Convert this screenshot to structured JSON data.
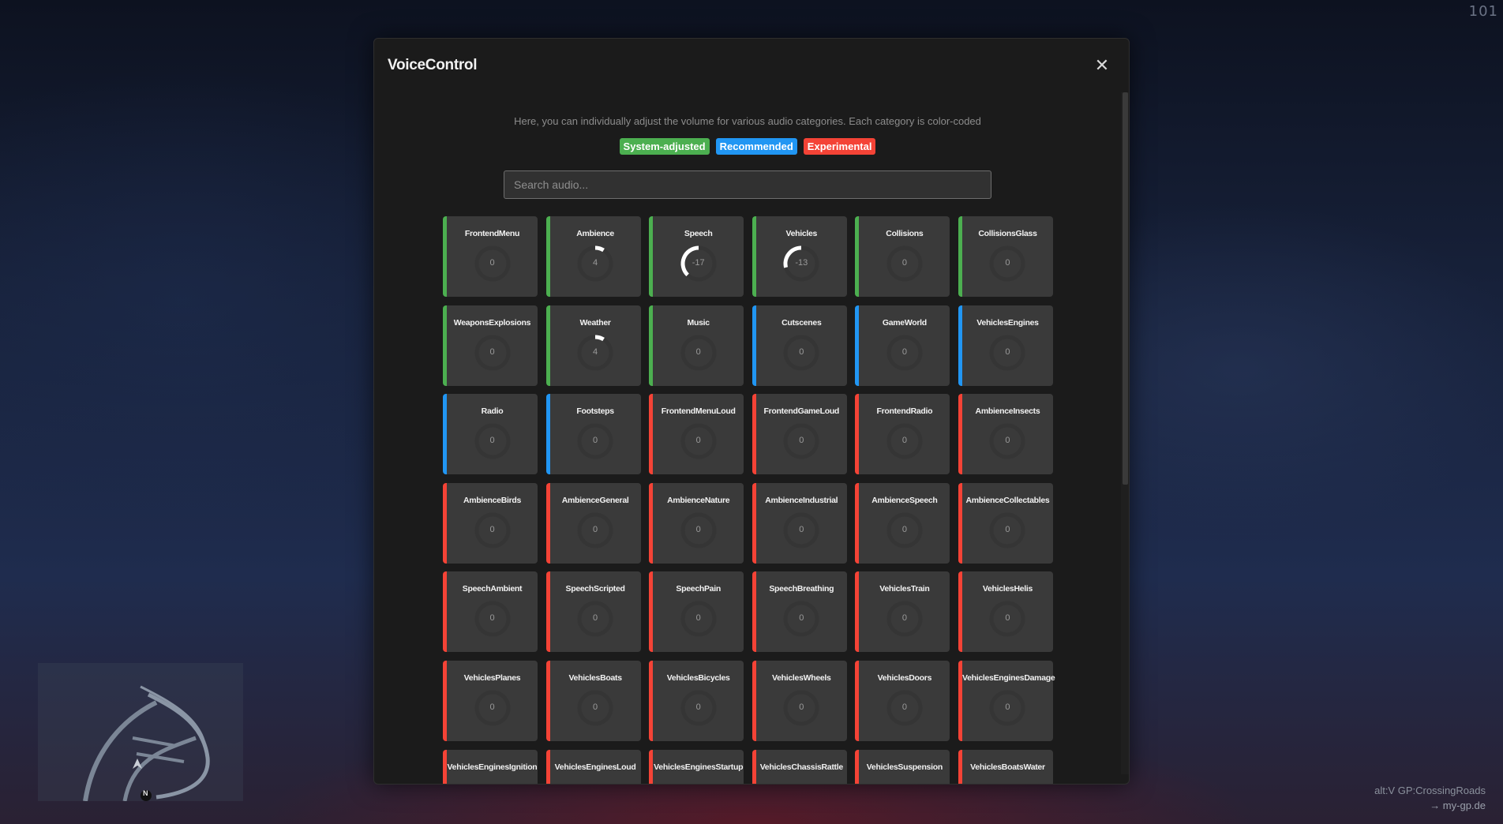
{
  "hud": {
    "fps": "101",
    "server_line1": "alt:V GP:CrossingRoads",
    "server_line2": "→ my-gp.de",
    "compass": "N"
  },
  "modal": {
    "title": "VoiceControl",
    "close_icon": "close-icon",
    "description": "Here, you can individually adjust the volume for various audio categories. Each category is color-coded",
    "legend": [
      {
        "label": "System-adjusted",
        "color": "#4caf50"
      },
      {
        "label": "Recommended",
        "color": "#2196f3"
      },
      {
        "label": "Experimental",
        "color": "#f44336"
      }
    ],
    "search_placeholder": "Search audio..."
  },
  "categories": [
    {
      "name": "FrontendMenu",
      "value": 0,
      "type": "system"
    },
    {
      "name": "Ambience",
      "value": 4,
      "type": "system"
    },
    {
      "name": "Speech",
      "value": -17,
      "type": "system"
    },
    {
      "name": "Vehicles",
      "value": -13,
      "type": "system"
    },
    {
      "name": "Collisions",
      "value": 0,
      "type": "system"
    },
    {
      "name": "CollisionsGlass",
      "value": 0,
      "type": "system"
    },
    {
      "name": "WeaponsExplosions",
      "value": 0,
      "type": "system"
    },
    {
      "name": "Weather",
      "value": 4,
      "type": "system"
    },
    {
      "name": "Music",
      "value": 0,
      "type": "system"
    },
    {
      "name": "Cutscenes",
      "value": 0,
      "type": "recommended"
    },
    {
      "name": "GameWorld",
      "value": 0,
      "type": "recommended"
    },
    {
      "name": "VehiclesEngines",
      "value": 0,
      "type": "recommended"
    },
    {
      "name": "Radio",
      "value": 0,
      "type": "recommended"
    },
    {
      "name": "Footsteps",
      "value": 0,
      "type": "recommended"
    },
    {
      "name": "FrontendMenuLoud",
      "value": 0,
      "type": "experimental"
    },
    {
      "name": "FrontendGameLoud",
      "value": 0,
      "type": "experimental"
    },
    {
      "name": "FrontendRadio",
      "value": 0,
      "type": "experimental"
    },
    {
      "name": "AmbienceInsects",
      "value": 0,
      "type": "experimental"
    },
    {
      "name": "AmbienceBirds",
      "value": 0,
      "type": "experimental"
    },
    {
      "name": "AmbienceGeneral",
      "value": 0,
      "type": "experimental"
    },
    {
      "name": "AmbienceNature",
      "value": 0,
      "type": "experimental"
    },
    {
      "name": "AmbienceIndustrial",
      "value": 0,
      "type": "experimental"
    },
    {
      "name": "AmbienceSpeech",
      "value": 0,
      "type": "experimental"
    },
    {
      "name": "AmbienceCollectables",
      "value": 0,
      "type": "experimental"
    },
    {
      "name": "SpeechAmbient",
      "value": 0,
      "type": "experimental"
    },
    {
      "name": "SpeechScripted",
      "value": 0,
      "type": "experimental"
    },
    {
      "name": "SpeechPain",
      "value": 0,
      "type": "experimental"
    },
    {
      "name": "SpeechBreathing",
      "value": 0,
      "type": "experimental"
    },
    {
      "name": "VehiclesTrain",
      "value": 0,
      "type": "experimental"
    },
    {
      "name": "VehiclesHelis",
      "value": 0,
      "type": "experimental"
    },
    {
      "name": "VehiclesPlanes",
      "value": 0,
      "type": "experimental"
    },
    {
      "name": "VehiclesBoats",
      "value": 0,
      "type": "experimental"
    },
    {
      "name": "VehiclesBicycles",
      "value": 0,
      "type": "experimental"
    },
    {
      "name": "VehiclesWheels",
      "value": 0,
      "type": "experimental"
    },
    {
      "name": "VehiclesDoors",
      "value": 0,
      "type": "experimental"
    },
    {
      "name": "VehiclesEnginesDamage",
      "value": 0,
      "type": "experimental"
    },
    {
      "name": "VehiclesEnginesIgnition",
      "value": null,
      "type": "experimental"
    },
    {
      "name": "VehiclesEnginesLoud",
      "value": null,
      "type": "experimental"
    },
    {
      "name": "VehiclesEnginesStartup",
      "value": null,
      "type": "experimental"
    },
    {
      "name": "VehiclesChassisRattle",
      "value": null,
      "type": "experimental"
    },
    {
      "name": "VehiclesSuspension",
      "value": null,
      "type": "experimental"
    },
    {
      "name": "VehiclesBoatsWater",
      "value": null,
      "type": "experimental"
    }
  ],
  "type_colors": {
    "system": "#4caf50",
    "recommended": "#2196f3",
    "experimental": "#f44336"
  }
}
